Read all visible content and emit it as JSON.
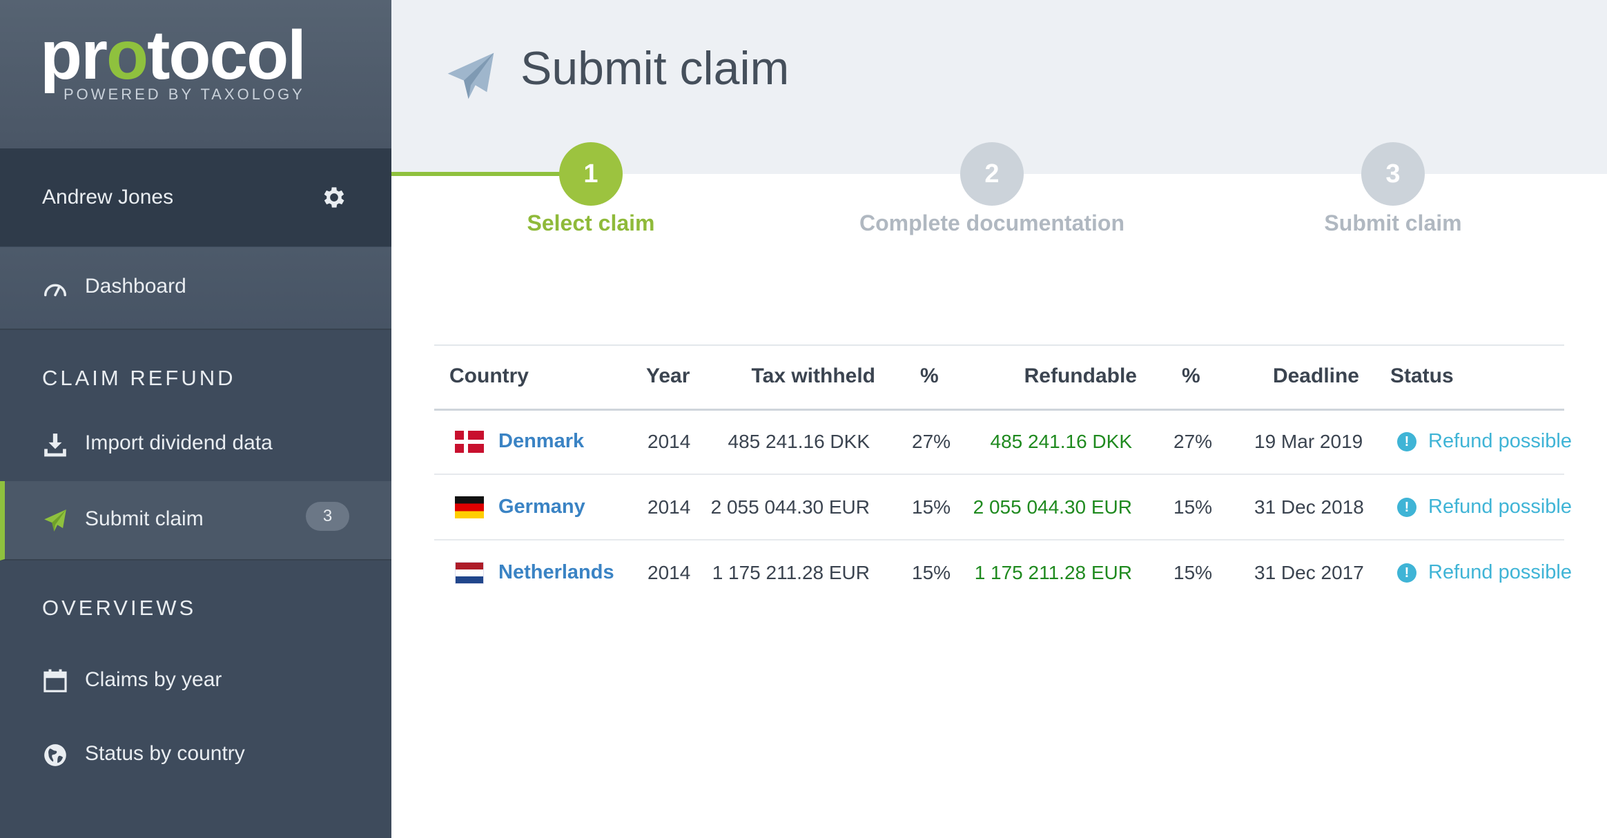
{
  "brand": {
    "logo_text_pre": "pr",
    "logo_text_o": "o",
    "logo_text_post": "tocol",
    "tagline": "POWERED BY TAXOLOGY"
  },
  "user": {
    "name": "Andrew Jones"
  },
  "sidebar": {
    "dashboard_label": "Dashboard",
    "section_claim": "CLAIM REFUND",
    "import_label": "Import dividend data",
    "submit_label": "Submit claim",
    "submit_badge": "3",
    "section_overviews": "OVERVIEWS",
    "claims_year_label": "Claims by year",
    "status_country_label": "Status by country"
  },
  "page": {
    "title": "Submit claim"
  },
  "steps": [
    {
      "number": "1",
      "label": "Select claim",
      "state": "active"
    },
    {
      "number": "2",
      "label": "Complete documentation",
      "state": "inactive"
    },
    {
      "number": "3",
      "label": "Submit claim",
      "state": "inactive"
    }
  ],
  "table": {
    "headers": [
      "Country",
      "Year",
      "Tax withheld",
      "%",
      "Refundable",
      "%",
      "Deadline",
      "Status"
    ],
    "rows": [
      {
        "country": "Denmark",
        "flag": "dk",
        "year": "2014",
        "tax_withheld": "485 241.16 DKK",
        "tax_pct": "27%",
        "refundable": "485 241.16 DKK",
        "refund_pct": "27%",
        "deadline": "19 Mar 2019",
        "status": "Refund possible"
      },
      {
        "country": "Germany",
        "flag": "de",
        "year": "2014",
        "tax_withheld": "2 055 044.30 EUR",
        "tax_pct": "15%",
        "refundable": "2 055 044.30 EUR",
        "refund_pct": "15%",
        "deadline": "31 Dec 2018",
        "status": "Refund possible"
      },
      {
        "country": "Netherlands",
        "flag": "nl",
        "year": "2014",
        "tax_withheld": "1 175 211.28 EUR",
        "tax_pct": "15%",
        "refundable": "1 175 211.28 EUR",
        "refund_pct": "15%",
        "deadline": "31 Dec 2017",
        "status": "Refund possible"
      }
    ]
  },
  "icons": {
    "settings": "gear-icon",
    "dashboard": "speedometer-icon",
    "import": "download-icon",
    "submit": "paper-plane-icon",
    "claims_year": "calendar-icon",
    "status_country": "globe-icon",
    "status": "exclamation-circle-icon"
  },
  "colors": {
    "accent_green": "#8fc13e",
    "link_blue": "#3a83c4",
    "status_cyan": "#3fb4d6",
    "refund_green": "#1f8a1f",
    "sidebar_bg": "#3e4b5c"
  }
}
